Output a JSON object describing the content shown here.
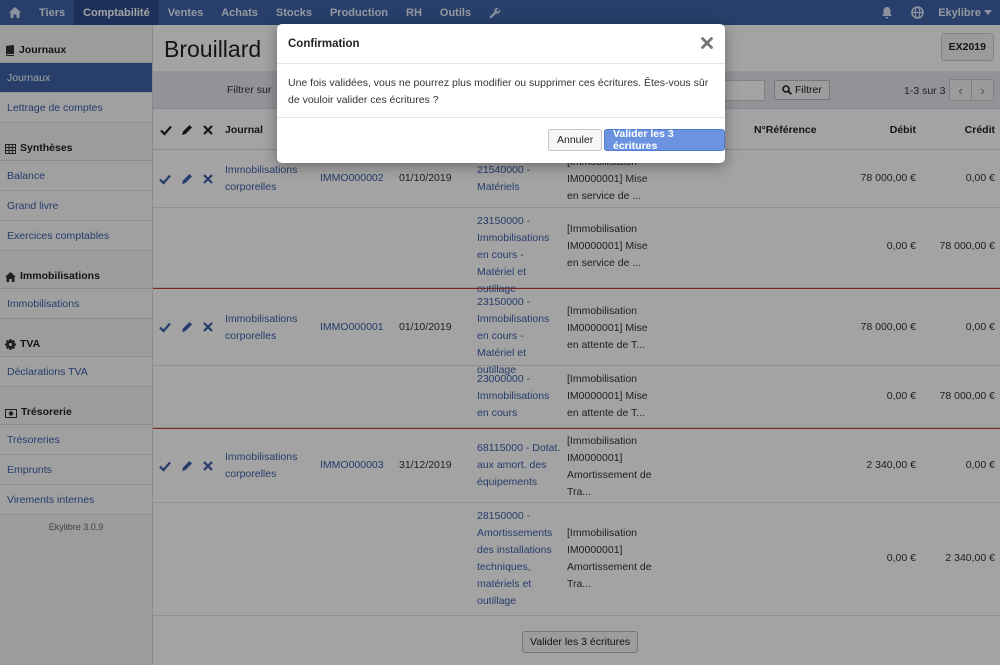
{
  "nav": {
    "items": [
      "Tiers",
      "Comptabilité",
      "Ventes",
      "Achats",
      "Stocks",
      "Production",
      "RH",
      "Outils"
    ],
    "active": "Comptabilité",
    "user": "Ekylibre",
    "icons": [
      "home-icon",
      "wrench-icon",
      "bell-icon",
      "globe-icon",
      "caret-down-icon"
    ]
  },
  "sidebar": {
    "sections": [
      {
        "title": "Journaux",
        "icon": "book-icon",
        "items": [
          "Journaux",
          "Lettrage de comptes"
        ]
      },
      {
        "title": "Synthèses",
        "icon": "table-icon",
        "items": [
          "Balance",
          "Grand livre",
          "Exercices comptables"
        ]
      },
      {
        "title": "Immobilisations",
        "icon": "house-icon",
        "items": [
          "Immobilisations"
        ]
      },
      {
        "title": "TVA",
        "icon": "gear-icon",
        "items": [
          "Déclarations TVA"
        ]
      },
      {
        "title": "Trésorerie",
        "icon": "money-icon",
        "items": [
          "Trésoreries",
          "Emprunts",
          "Virements internes"
        ]
      }
    ],
    "active_item": "Journaux",
    "version": "Ekylibre 3.0.9"
  },
  "page": {
    "title": "Brouillard",
    "exercise_button": "EX2019",
    "filter_label": "Filtrer sur",
    "filter_button": "Filtrer",
    "pager_info": "1-3 sur 3",
    "bottom_button": "Valider les 3 écritures"
  },
  "table": {
    "headers": {
      "journal": "Journal",
      "ref": "N°Référence",
      "debit": "Débit",
      "credit": "Crédit"
    },
    "rows": [
      {
        "journal": "Immobilisations corporelles",
        "number": "IMMO000002",
        "date": "01/10/2019",
        "account": "21540000 - Matériels",
        "label": "[Immobilisation IM0000001] Mise en service de ...",
        "debit": "78 000,00 €",
        "credit": "0,00 €"
      },
      {
        "journal": "",
        "number": "",
        "date": "",
        "account": "23150000 - Immobilisations en cours - Matériel et outillage",
        "label": "[Immobilisation IM0000001] Mise en service de ...",
        "debit": "0,00 €",
        "credit": "78 000,00 €"
      },
      {
        "journal": "Immobilisations corporelles",
        "number": "IMMO000001",
        "date": "01/10/2019",
        "account": "23150000 - Immobilisations en cours - Matériel et outillage",
        "label": "[Immobilisation IM0000001] Mise en attente de T...",
        "debit": "78 000,00 €",
        "credit": "0,00 €"
      },
      {
        "journal": "",
        "number": "",
        "date": "",
        "account": "23000000 - Immobilisations en cours",
        "label": "[Immobilisation IM0000001] Mise en attente de T...",
        "debit": "0,00 €",
        "credit": "78 000,00 €"
      },
      {
        "journal": "Immobilisations corporelles",
        "number": "IMMO000003",
        "date": "31/12/2019",
        "account": "68115000 - Dotat. aux amort. des équipements",
        "label": "[Immobilisation IM0000001] Amortissement de Tra...",
        "debit": "2 340,00 €",
        "credit": "0,00 €"
      },
      {
        "journal": "",
        "number": "",
        "date": "",
        "account": "28150000 - Amortissements des installations techniques, matériels et outillage",
        "label": "[Immobilisation IM0000001] Amortissement de Tra...",
        "debit": "0,00 €",
        "credit": "2 340,00 €"
      }
    ]
  },
  "modal": {
    "title": "Confirmation",
    "message": "Une fois validées, vous ne pourrez plus modifier ou supprimer ces écritures. Êtes-vous sûr de vouloir valider ces écritures ?",
    "cancel": "Annuler",
    "confirm": "Valider les 3 écritures"
  }
}
